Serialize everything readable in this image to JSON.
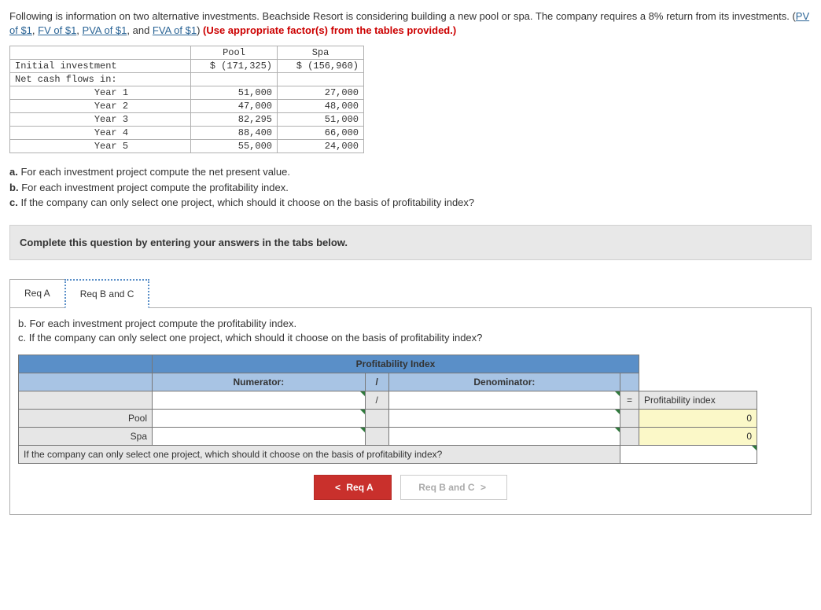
{
  "intro": {
    "text1": "Following is information on two alternative investments. Beachside Resort is considering building a new pool or spa. The company requires a 8% return from its investments. (",
    "link1": "PV of $1",
    "sep1": ", ",
    "link2": "FV of $1",
    "sep2": ", ",
    "link3": "PVA of $1",
    "sep3": ", and ",
    "link4": "FVA of $1",
    "text2": ") ",
    "red": "(Use appropriate factor(s) from the tables provided.)"
  },
  "dataTable": {
    "header": {
      "c1": "Pool",
      "c2": "Spa"
    },
    "rows": [
      {
        "label": "Initial investment",
        "c1": "$ (171,325)",
        "c2": "$ (156,960)"
      },
      {
        "label": "Net cash flows in:",
        "c1": "",
        "c2": ""
      },
      {
        "label": "              Year 1",
        "c1": "51,000",
        "c2": "27,000"
      },
      {
        "label": "              Year 2",
        "c1": "47,000",
        "c2": "48,000"
      },
      {
        "label": "              Year 3",
        "c1": "82,295",
        "c2": "51,000"
      },
      {
        "label": "              Year 4",
        "c1": "88,400",
        "c2": "66,000"
      },
      {
        "label": "              Year 5",
        "c1": "55,000",
        "c2": "24,000"
      }
    ]
  },
  "questions": {
    "a": "a. For each investment project compute the net present value.",
    "b": "b. For each investment project compute the profitability index.",
    "c": "c. If the company can only select one project, which should it choose on the basis of profitability index?"
  },
  "instruction": "Complete this question by entering your answers in the tabs below.",
  "tabs": {
    "a": "Req A",
    "bc": "Req B and C"
  },
  "tabBody": {
    "line1": "b. For each investment project compute the profitability index.",
    "line2": "c. If the company can only select one project, which should it choose on the basis of profitability index?"
  },
  "answerTable": {
    "title": "Profitability Index",
    "numerator": "Numerator:",
    "slash": "/",
    "denominator": "Denominator:",
    "equals": "=",
    "resultHeader": "Profitability index",
    "rows": [
      {
        "label": "Pool",
        "result": "0"
      },
      {
        "label": "Spa",
        "result": "0"
      }
    ],
    "question": "If the company can only select one project, which should it choose on the basis of profitability index?"
  },
  "nav": {
    "prevChev": "<",
    "prev": "Req A",
    "next": "Req B and C",
    "nextChev": ">"
  }
}
